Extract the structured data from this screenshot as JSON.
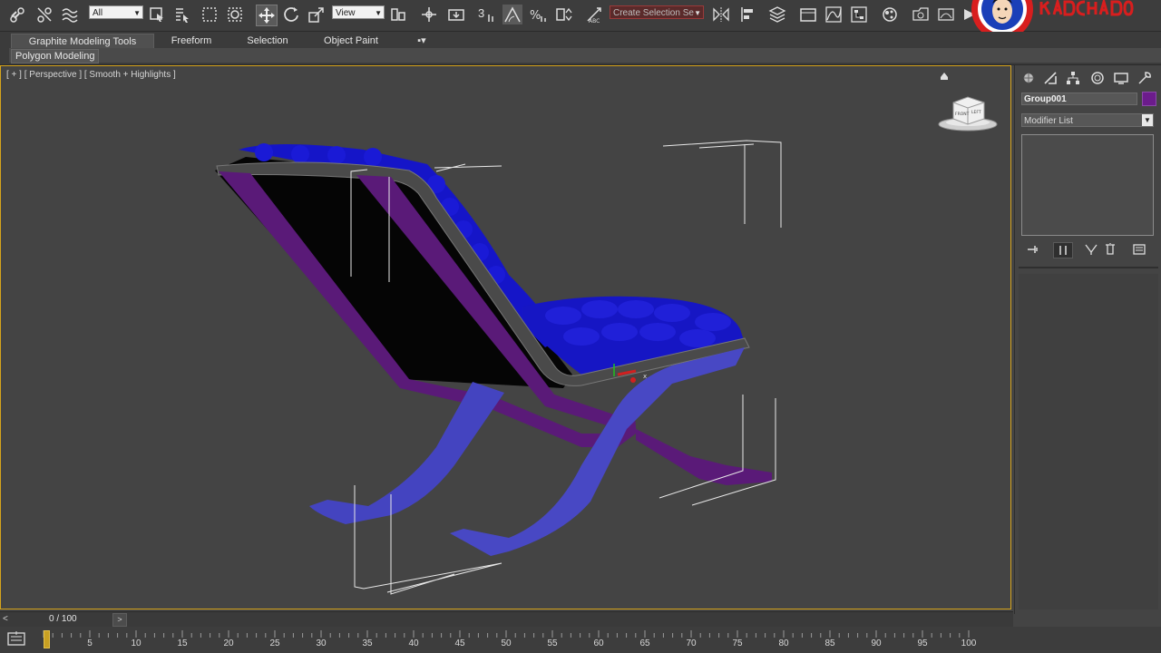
{
  "toolbar": {
    "selection_filter": "All",
    "reference_coord": "View",
    "snaps_count": "3",
    "named_selection_placeholder": "Create Selection Se",
    "icons": [
      "link-icon",
      "unlink-icon",
      "bind-space-warp-icon",
      "select-object-icon",
      "select-by-name-icon",
      "rect-region-icon",
      "window-crossing-icon",
      "move-icon",
      "rotate-icon",
      "scale-icon",
      "pivot-icon",
      "manipulate-icon",
      "keyboard-shortcut-icon",
      "snap-icon",
      "angle-snap-icon",
      "percent-snap-icon",
      "spinner-snap-icon",
      "edit-named-selection-icon",
      "mirror-icon",
      "align-icon",
      "layer-manager-icon",
      "graphite-toggle-icon",
      "curve-editor-icon",
      "schematic-view-icon",
      "material-editor-icon",
      "render-setup-icon",
      "rendered-frame-icon",
      "render-icon"
    ]
  },
  "ribbon": {
    "tabs": [
      "Graphite Modeling Tools",
      "Freeform",
      "Selection",
      "Object Paint"
    ],
    "active_tab": "Graphite Modeling Tools",
    "panel_label": "Polygon Modeling"
  },
  "viewport": {
    "label": "[ + ] [ Perspective ] [ Smooth + Highlights ]",
    "viewcube_front": "FRONT",
    "viewcube_left": "LEFT"
  },
  "command_panel": {
    "object_name": "Group001",
    "object_color": "#6c1c8c",
    "modifier_list": "Modifier List",
    "tabs": [
      "create-icon",
      "modify-icon",
      "hierarchy-icon",
      "motion-icon",
      "display-icon",
      "utilities-icon"
    ],
    "stack_buttons": [
      "pin-stack-icon",
      "show-end-result-icon",
      "make-unique-icon",
      "remove-modifier-icon",
      "configure-modifier-sets-icon"
    ]
  },
  "timeline": {
    "frame_label": "0 / 100",
    "prev": "<",
    "next": ">",
    "ticks": [
      "5",
      "10",
      "15",
      "20",
      "25",
      "30",
      "35",
      "40",
      "45",
      "50",
      "55",
      "60",
      "65",
      "70",
      "75",
      "80",
      "85",
      "90",
      "95",
      "100"
    ],
    "current_frame": 0,
    "total_frames": 100
  },
  "colors": {
    "accent_border": "#d6a41c",
    "chair_frame": "#5a1a78",
    "chair_cushion": "#1c1cc8",
    "chair_legs": "#4444c0"
  }
}
